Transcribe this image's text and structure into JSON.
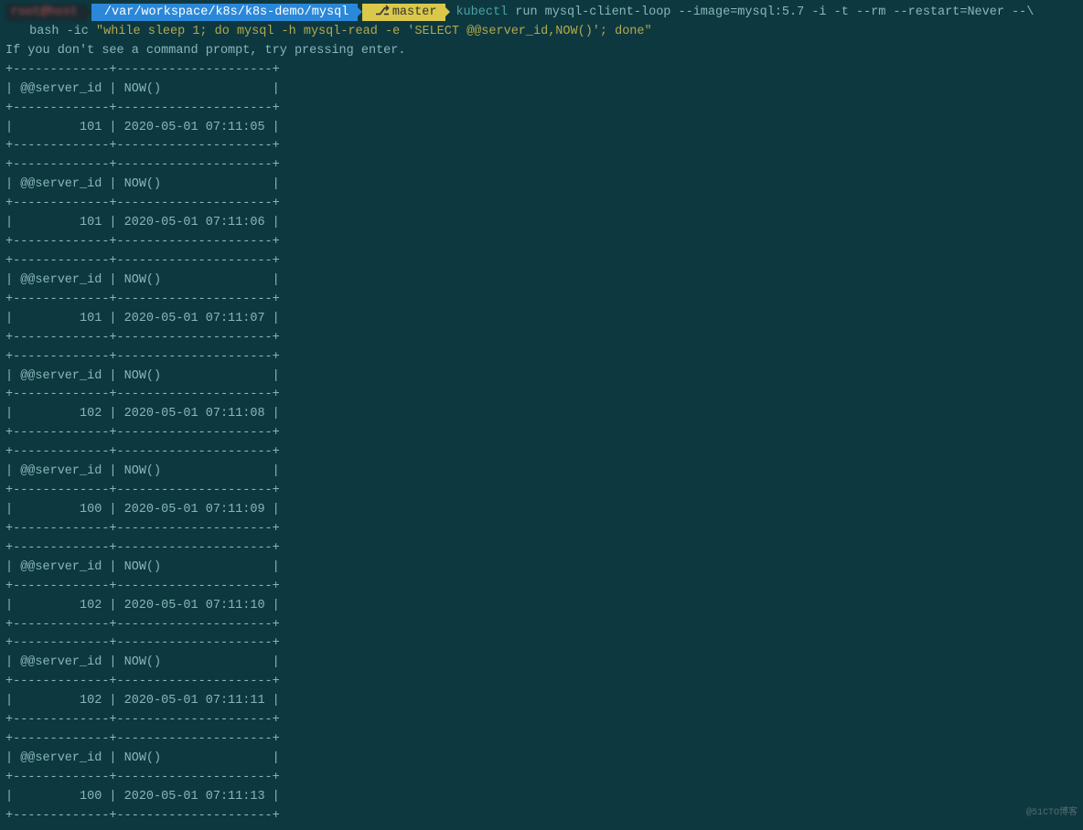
{
  "prompt": {
    "host": "root@host",
    "path": "/var/workspace/k8s/k8s-demo/mysql",
    "git_icon": "⎇",
    "branch": "master",
    "cmd_keyword": "kubectl",
    "cmd_rest": "run mysql-client-loop --image=mysql:5.7 -i -t --rm --restart=Never --\\",
    "line2_prefix": " bash -ic ",
    "line2_string": "\"while sleep 1; do mysql -h mysql-read -e 'SELECT @@server_id,NOW()'; done\""
  },
  "hint": "If you don't see a command prompt, try pressing enter.",
  "table": {
    "border": "+-------------+---------------------+",
    "header": "| @@server_id | NOW()               |",
    "rows": [
      {
        "server_id": "101",
        "now": "2020-05-01 07:11:05"
      },
      {
        "server_id": "101",
        "now": "2020-05-01 07:11:06"
      },
      {
        "server_id": "101",
        "now": "2020-05-01 07:11:07"
      },
      {
        "server_id": "102",
        "now": "2020-05-01 07:11:08"
      },
      {
        "server_id": "100",
        "now": "2020-05-01 07:11:09"
      },
      {
        "server_id": "102",
        "now": "2020-05-01 07:11:10"
      },
      {
        "server_id": "102",
        "now": "2020-05-01 07:11:11"
      },
      {
        "server_id": "100",
        "now": "2020-05-01 07:11:13"
      }
    ]
  },
  "watermark": "@51CTO博客"
}
